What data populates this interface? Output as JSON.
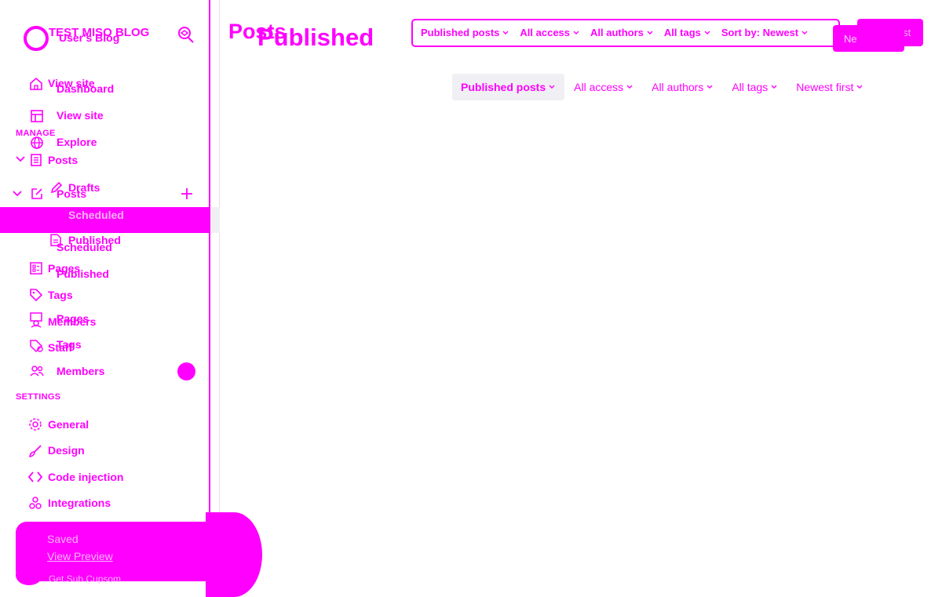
{
  "colors": {
    "accent": "#ff00ff",
    "background": "#ffffff",
    "hover_bg": "#f0f0f4"
  },
  "sidebar": {
    "blog_title_a": "TEST MISO BLOG",
    "blog_title_b": "User's Blog",
    "top_a": [
      {
        "label": "View site",
        "icon": "home-icon"
      }
    ],
    "top_b": [
      {
        "label": "Dashboard",
        "icon": "home-icon"
      },
      {
        "label": "View site",
        "icon": "layout-icon"
      },
      {
        "label": "Explore",
        "icon": "globe-icon"
      }
    ],
    "manage_label": "MANAGE",
    "posts_a": "Posts",
    "posts_b": "Posts",
    "drafts": "Drafts",
    "scheduled_a": "Scheduled",
    "scheduled_b": "Scheduled",
    "published_a": "Published",
    "published_b": "Published",
    "pages_a": "Pages",
    "pages_b": "Pages",
    "tags_a": "Tags",
    "tags_b": "Tags",
    "members_a": "Members",
    "members_b": "Members",
    "staff": "Staff",
    "settings_label": "SETTINGS",
    "settings_items": [
      {
        "label": "General",
        "icon": "gear-icon"
      },
      {
        "label": "Design",
        "icon": "brush-icon"
      },
      {
        "label": "Code injection",
        "icon": "code-icon"
      },
      {
        "label": "Integrations",
        "icon": "integrations-icon"
      }
    ]
  },
  "toast": {
    "title": "Saved",
    "link": "View Preview",
    "footer": "Get Sub Cupsom"
  },
  "header": {
    "title_a": "Posts",
    "title_b": "Published",
    "new_post_a": "New post",
    "new_post_b": "Ne"
  },
  "filters_top": [
    "Published posts",
    "All access",
    "All authors",
    "All tags",
    "Sort by: Newest"
  ],
  "filters_main": [
    "Published posts",
    "All access",
    "All authors",
    "All tags",
    "Newest first"
  ]
}
